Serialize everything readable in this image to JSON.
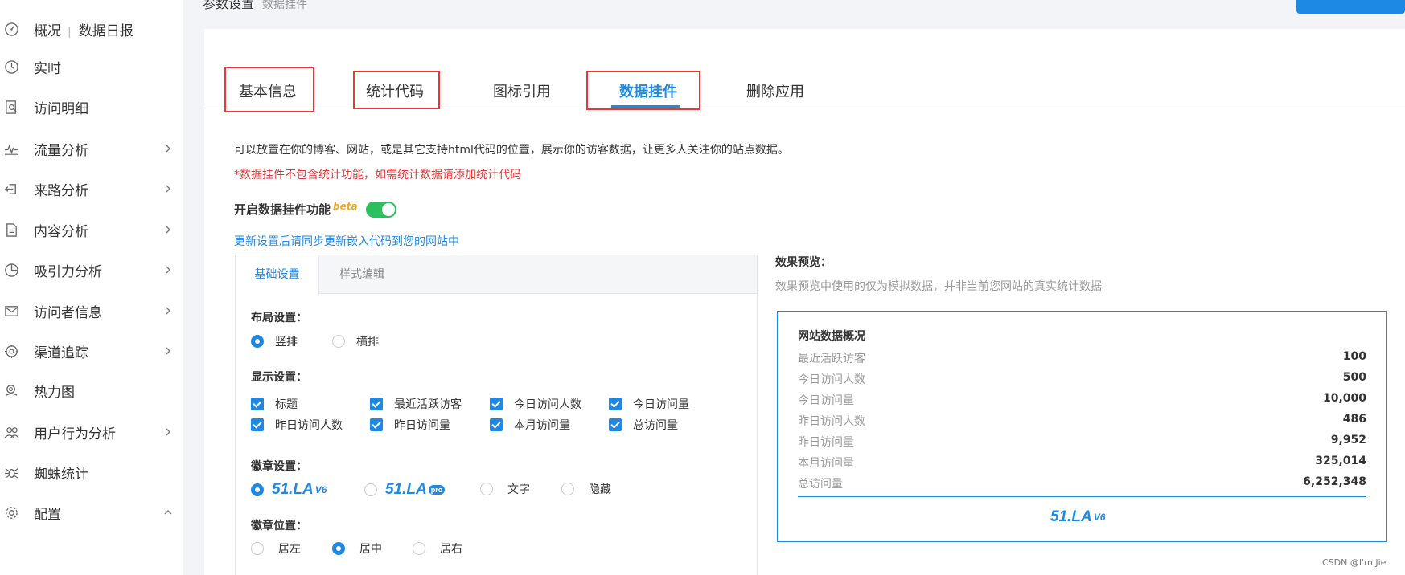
{
  "sidebar": {
    "items": [
      {
        "label": "概况",
        "extra": "数据日报",
        "icon": "dashboard-icon",
        "chevron": false
      },
      {
        "label": "实时",
        "icon": "clock-icon",
        "chevron": false
      },
      {
        "label": "访问明细",
        "icon": "document-search-icon",
        "chevron": false
      },
      {
        "label": "流量分析",
        "icon": "pulse-icon",
        "chevron": true
      },
      {
        "label": "来路分析",
        "icon": "login-icon",
        "chevron": true
      },
      {
        "label": "内容分析",
        "icon": "file-icon",
        "chevron": true
      },
      {
        "label": "吸引力分析",
        "icon": "pie-icon",
        "chevron": true
      },
      {
        "label": "访问者信息",
        "icon": "mail-icon",
        "chevron": true
      },
      {
        "label": "渠道追踪",
        "icon": "target-icon",
        "chevron": true
      },
      {
        "label": "热力图",
        "icon": "heatmap-icon",
        "chevron": false
      },
      {
        "label": "用户行为分析",
        "icon": "users-icon",
        "chevron": true
      },
      {
        "label": "蜘蛛统计",
        "icon": "spider-icon",
        "chevron": false
      },
      {
        "label": "配置",
        "icon": "gear-icon",
        "chevron": true
      }
    ]
  },
  "header": {
    "title": "参数设置",
    "subtitle": "数据挂件"
  },
  "tabs": [
    {
      "label": "基本信息"
    },
    {
      "label": "统计代码"
    },
    {
      "label": "图标引用"
    },
    {
      "label": "数据挂件"
    },
    {
      "label": "删除应用"
    }
  ],
  "main": {
    "description": "可以放置在你的博客、网站，或是其它支持html代码的位置，展示你的访客数据，让更多人关注你的站点数据。",
    "warning": "*数据挂件不包含统计功能，如需统计数据请添加统计代码",
    "enable_label": "开启数据挂件功能",
    "beta": "beta",
    "sync_link": "更新设置后请同步更新嵌入代码到您的网站中"
  },
  "settings": {
    "subtabs": [
      "基础设置",
      "样式编辑"
    ],
    "layout": {
      "title": "布局设置：",
      "options": [
        "竖排",
        "横排"
      ],
      "selected": "竖排"
    },
    "display": {
      "title": "显示设置：",
      "options": [
        "标题",
        "最近活跃访客",
        "今日访问人数",
        "今日访问量",
        "昨日访问人数",
        "昨日访问量",
        "本月访问量",
        "总访问量"
      ]
    },
    "badge": {
      "title": "徽章设置：",
      "logo_text": "51.LA",
      "logo_v6": "V6",
      "logo_pro": "pro",
      "text_option": "文字",
      "hide_option": "隐藏"
    },
    "position": {
      "title": "徽章位置：",
      "options": [
        "居左",
        "居中",
        "居右"
      ],
      "selected": "居中"
    }
  },
  "preview": {
    "title": "效果预览：",
    "subtitle": "效果预览中使用的仅为模拟数据，并非当前您网站的真实统计数据",
    "box_title": "网站数据概况",
    "rows": [
      {
        "label": "最近活跃访客",
        "value": "100"
      },
      {
        "label": "今日访问人数",
        "value": "500"
      },
      {
        "label": "今日访问量",
        "value": "10,000"
      },
      {
        "label": "昨日访问人数",
        "value": "486"
      },
      {
        "label": "昨日访问量",
        "value": "9,952"
      },
      {
        "label": "本月访问量",
        "value": "325,014"
      },
      {
        "label": "总访问量",
        "value": "6,252,348"
      }
    ],
    "logo_text": "51.LA",
    "logo_v6": "V6"
  },
  "watermark": "CSDN @I'm Jie",
  "colors": {
    "accent": "#1e88e5",
    "toggle_on": "#2bbf5d",
    "warning": "#e53935",
    "beta": "#f5a623"
  }
}
